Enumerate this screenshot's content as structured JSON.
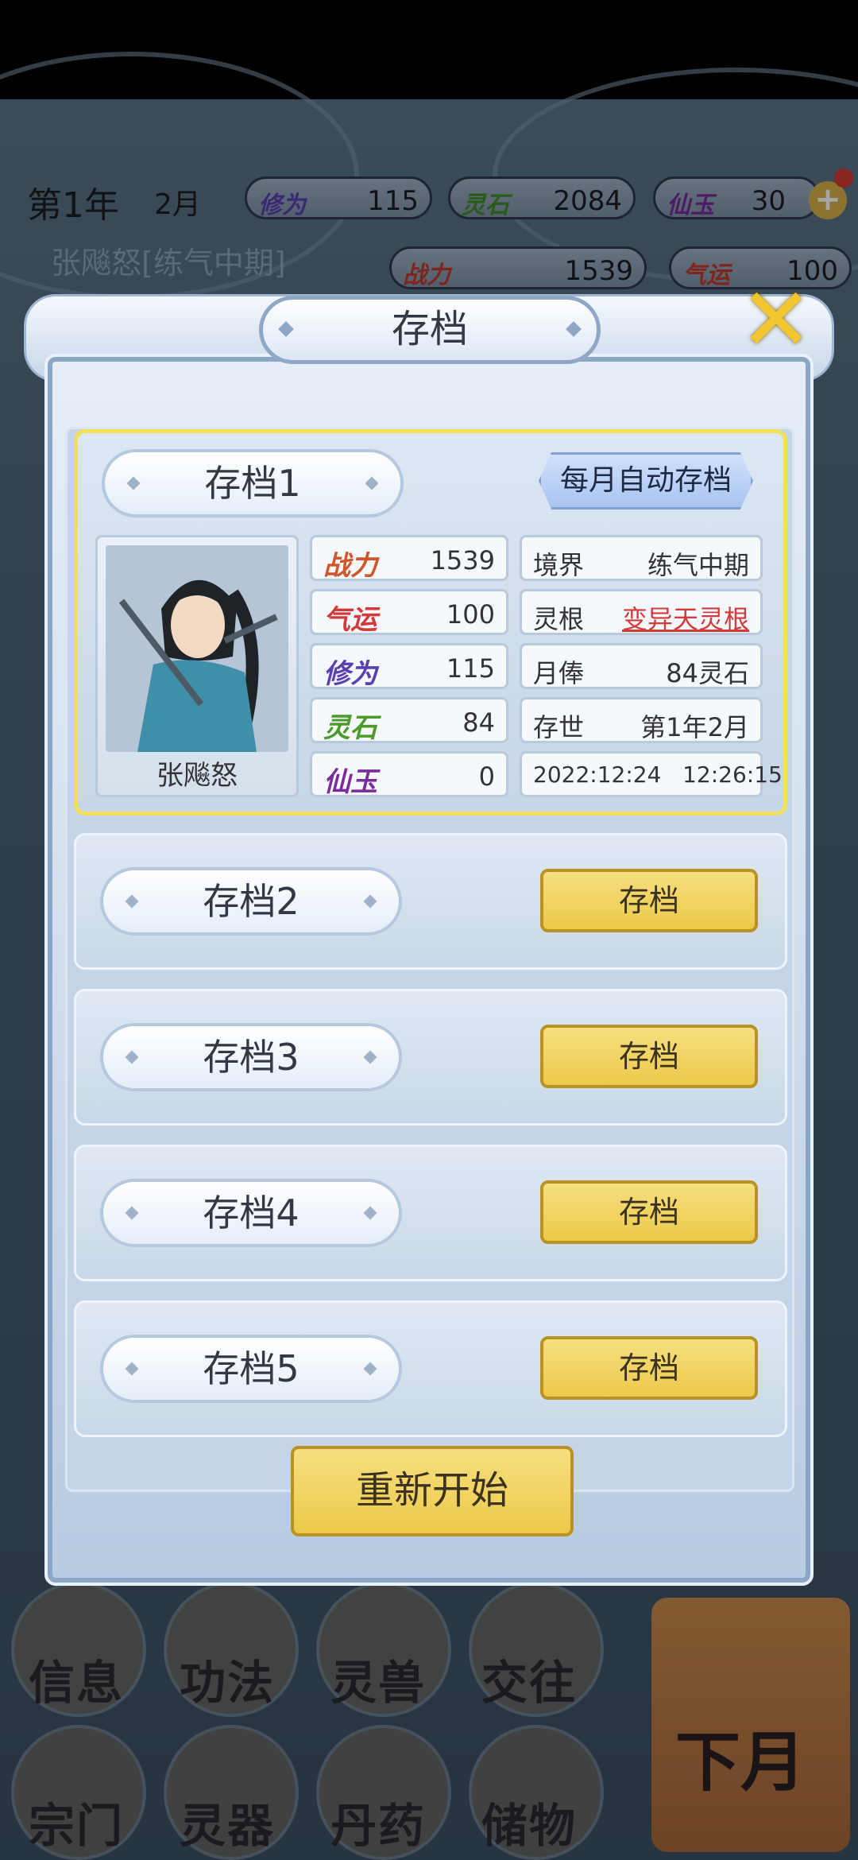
{
  "hud": {
    "year": "第1年",
    "month": "2月",
    "character": "张飚怒[练气中期]",
    "stats_row1": [
      {
        "label": "修为",
        "value": "115",
        "color": "#5a3fb0"
      },
      {
        "label": "灵石",
        "value": "2084",
        "color": "#3e8a2a"
      },
      {
        "label": "仙玉",
        "value": "30",
        "color": "#7a2c9a"
      }
    ],
    "stats_row2": [
      {
        "label": "战力",
        "value": "1539",
        "color": "#c0392b"
      },
      {
        "label": "气运",
        "value": "100",
        "color": "#c0392b"
      }
    ],
    "plus_glyph": "+"
  },
  "dialog": {
    "title": "存档",
    "close_glyph": "✕",
    "restart_label": "重新开始",
    "slots": [
      {
        "name": "存档1",
        "auto_label": "每月自动存档",
        "portrait_name": "张飚怒",
        "left_stats": [
          {
            "label": "战力",
            "value": "1539",
            "color": "#d0562a"
          },
          {
            "label": "气运",
            "value": "100",
            "color": "#d23a3a"
          },
          {
            "label": "修为",
            "value": "115",
            "color": "#5a3fb0"
          },
          {
            "label": "灵石",
            "value": "84",
            "color": "#4c9a2a"
          },
          {
            "label": "仙玉",
            "value": "0",
            "color": "#7a2c9a"
          }
        ],
        "right_info": [
          {
            "label": "境界",
            "value": "练气中期"
          },
          {
            "label": "灵根",
            "value": "变异天灵根"
          },
          {
            "label": "月俸",
            "value": "84灵石"
          },
          {
            "label": "存世",
            "value": "第1年2月"
          },
          {
            "label": "",
            "value": "2022:12:24   12:26:15"
          }
        ]
      },
      {
        "name": "存档2",
        "button": "存档"
      },
      {
        "name": "存档3",
        "button": "存档"
      },
      {
        "name": "存档4",
        "button": "存档"
      },
      {
        "name": "存档5",
        "button": "存档"
      }
    ]
  },
  "bottom_nav": {
    "row1": [
      "信息",
      "功法",
      "灵兽",
      "交往"
    ],
    "row2": [
      "宗门",
      "灵器",
      "丹药",
      "储物"
    ],
    "next_month": "下月"
  }
}
